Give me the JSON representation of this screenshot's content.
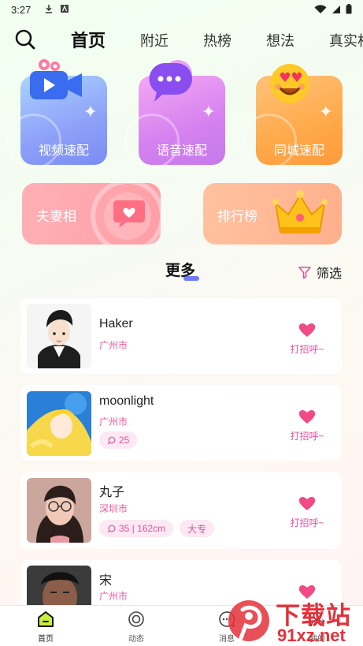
{
  "status_bar": {
    "time": "3:27"
  },
  "nav": {
    "tabs": [
      {
        "label": "首页",
        "active": true
      },
      {
        "label": "附近"
      },
      {
        "label": "热榜"
      },
      {
        "label": "想法"
      },
      {
        "label": "真实相"
      }
    ]
  },
  "quick_match": [
    {
      "label": "视频速配",
      "icon": "video-camera-icon",
      "color": "#7f92f6"
    },
    {
      "label": "语音速配",
      "icon": "chat-bubble-icon",
      "color": "#d57cf2"
    },
    {
      "label": "同城速配",
      "icon": "heart-eyes-emoji-icon",
      "color": "#ffaa3d"
    }
  ],
  "feature_cards": [
    {
      "label": "夫妻相",
      "icon": "heart-message-icon"
    },
    {
      "label": "排行榜",
      "icon": "crown-icon"
    }
  ],
  "section": {
    "title": "更多",
    "filter_label": "筛选"
  },
  "users": [
    {
      "name": "Haker",
      "city": "广州市",
      "tags": [],
      "greet": "打招呼~"
    },
    {
      "name": "moonlight",
      "city": "广州市",
      "tags": [
        {
          "text": "25",
          "icon": true
        }
      ],
      "greet": "打招呼~"
    },
    {
      "name": "丸子",
      "city": "深圳市",
      "tags": [
        {
          "text": "35 | 162cm",
          "icon": true
        },
        {
          "text": "大专",
          "icon": false
        }
      ],
      "greet": "打招呼~"
    },
    {
      "name": "宋",
      "city": "广州市",
      "tags": [],
      "greet": ""
    }
  ],
  "bottom_nav": [
    {
      "label": "首页",
      "active": true
    },
    {
      "label": "动态"
    },
    {
      "label": "消息"
    },
    {
      "label": "我的"
    }
  ],
  "watermark": {
    "cn": "下载站",
    "url": "91xz.net"
  },
  "colors": {
    "accent": "#6f7df3",
    "pink": "#e2549a",
    "heart": "#f04b86"
  }
}
